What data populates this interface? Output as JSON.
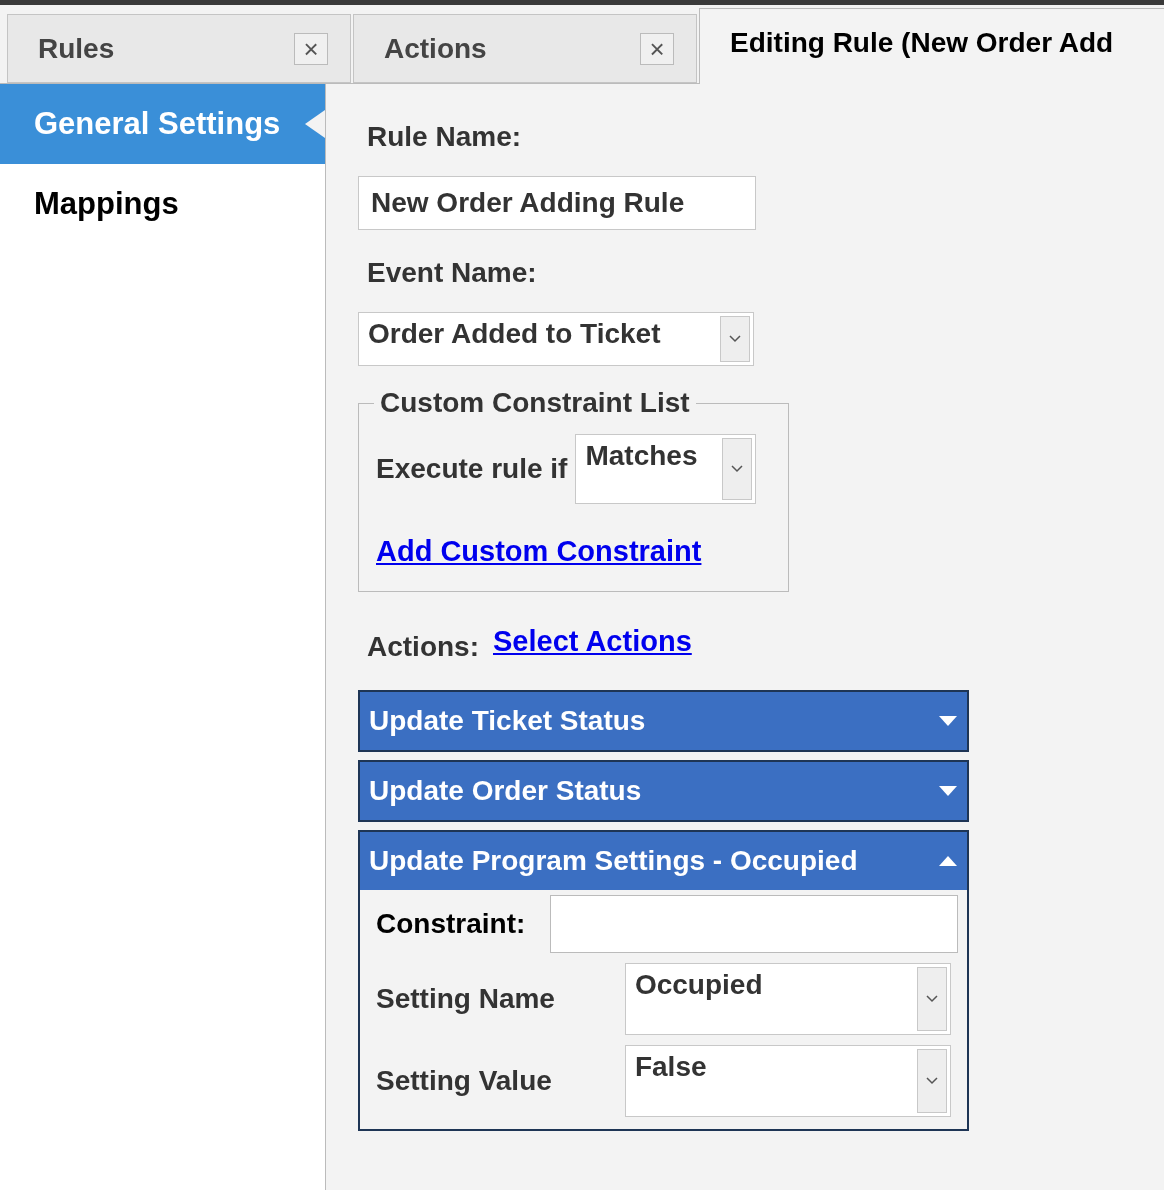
{
  "tabs": [
    {
      "label": "Rules",
      "close": "×",
      "selected": false
    },
    {
      "label": "Actions",
      "close": "×",
      "selected": false
    },
    {
      "label": "Editing Rule (New Order Add",
      "selected": true
    }
  ],
  "sidebar": {
    "items": [
      {
        "label": "General Settings",
        "selected": true
      },
      {
        "label": "Mappings",
        "selected": false
      }
    ]
  },
  "form": {
    "rule_name_label": "Rule Name:",
    "rule_name_value": "New Order Adding Rule",
    "event_name_label": "Event Name:",
    "event_name_value": "Order Added to Ticket",
    "constraint_group": {
      "legend": "Custom Constraint List",
      "execute_label": "Execute rule if",
      "match_value": "Matches",
      "add_link": "Add Custom Constraint"
    },
    "actions_label": "Actions:",
    "select_actions_link": "Select Actions",
    "action_panels": [
      {
        "title": "Update Ticket Status",
        "expanded": false
      },
      {
        "title": "Update Order Status",
        "expanded": false
      },
      {
        "title": "Update Program Settings - Occupied",
        "expanded": true,
        "fields": [
          {
            "kind": "text",
            "label": "Constraint:"
          },
          {
            "kind": "select",
            "label": "Setting Name",
            "value": "Occupied"
          },
          {
            "kind": "select",
            "label": "Setting Value",
            "value": "False"
          }
        ]
      }
    ]
  }
}
